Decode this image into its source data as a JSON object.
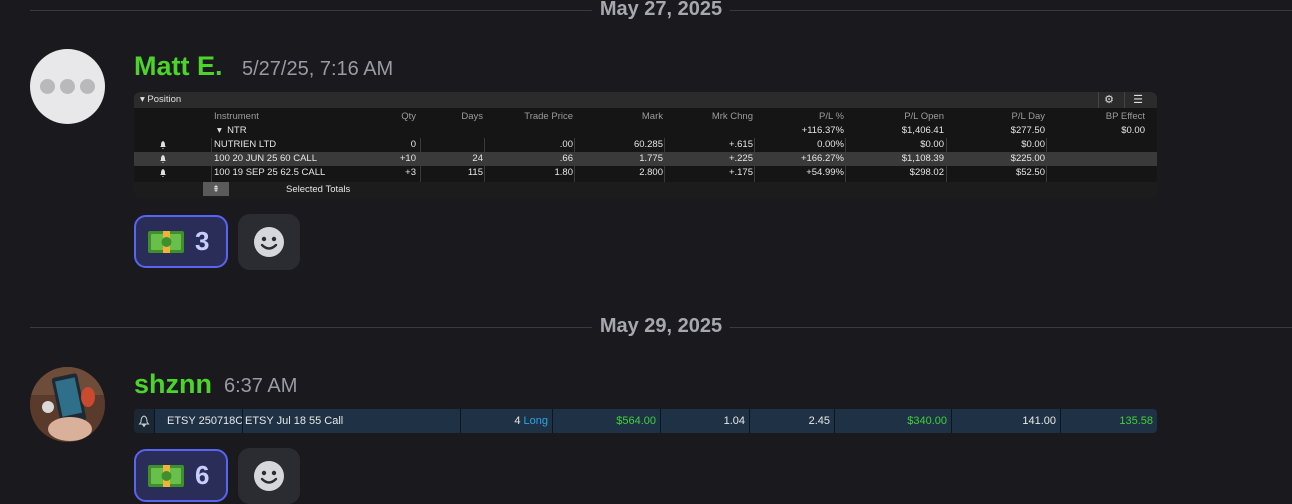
{
  "dates": [
    "May 27, 2025",
    "May 29, 2025"
  ],
  "messages": [
    {
      "author": "Matt E.",
      "time": "5/27/25, 7:16 AM",
      "position_panel": {
        "title": "Position",
        "columns": [
          "Instrument",
          "Qty",
          "Days",
          "Trade Price",
          "Mark",
          "Mrk Chng",
          "P/L %",
          "P/L Open",
          "P/L Day",
          "BP Effect"
        ],
        "group": {
          "instrument": "NTR",
          "pl_pct": "+116.37%",
          "pl_open": "$1,406.41",
          "pl_day": "$277.50",
          "bp_effect": "$0.00"
        },
        "rows": [
          {
            "instrument": "NUTRIEN LTD",
            "qty": "0",
            "days": "",
            "trade_price": ".00",
            "mark": "60.285",
            "mrk_chng": "+.615",
            "pl_pct": "0.00%",
            "pl_open": "$0.00",
            "pl_day": "$0.00",
            "bp_effect": ""
          },
          {
            "instrument": "100 20 JUN 25 60 CALL",
            "qty": "+10",
            "days": "24",
            "trade_price": ".66",
            "mark": "1.775",
            "mrk_chng": "+.225",
            "pl_pct": "+166.27%",
            "pl_open": "$1,108.39",
            "pl_day": "$225.00",
            "bp_effect": ""
          },
          {
            "instrument": "100 19 SEP 25 62.5 CALL",
            "qty": "+3",
            "days": "115",
            "trade_price": "1.80",
            "mark": "2.800",
            "mrk_chng": "+.175",
            "pl_pct": "+54.99%",
            "pl_open": "$298.02",
            "pl_day": "$52.50",
            "bp_effect": ""
          }
        ],
        "footer": "Selected Totals"
      },
      "reaction": {
        "emoji": "money-with-wings",
        "count": "3"
      }
    },
    {
      "author": "shznn",
      "time": "6:37 AM",
      "position_strip": {
        "symbol": "ETSY 250718C",
        "description": "ETSY Jul 18 55 Call",
        "qty": "4",
        "side": "Long",
        "value1": "$564.00",
        "value2": "1.04",
        "value3": "2.45",
        "value4": "$340.00",
        "value5": "141.00",
        "value6": "135.58"
      },
      "reaction": {
        "emoji": "money-with-wings",
        "count": "6"
      }
    }
  ],
  "colors": {
    "username": "#4cd42c",
    "reaction_border": "#5865f2",
    "green": "#3fd23a",
    "blue": "#2aa6e8"
  }
}
